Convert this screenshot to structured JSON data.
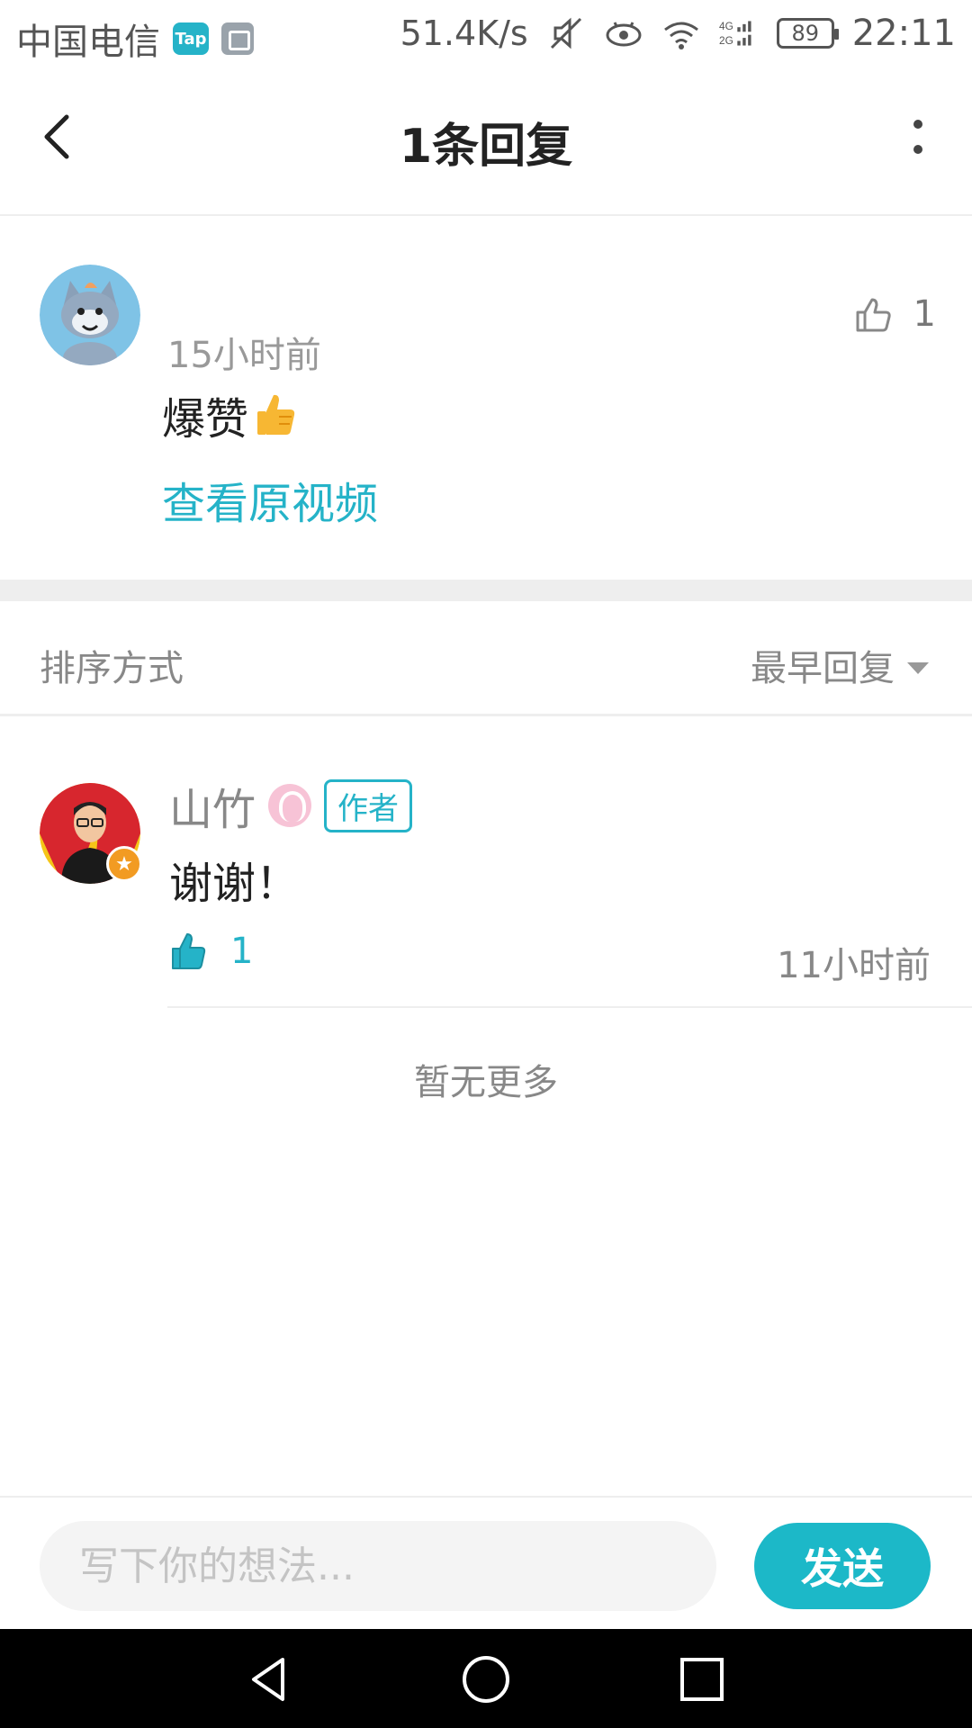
{
  "status_bar": {
    "carrier": "中国电信",
    "tap_badge": "Tap",
    "net_speed": "51.4K/s",
    "network_label_top": "4G",
    "network_label_bottom": "2G",
    "battery": "89",
    "time": "22:11"
  },
  "header": {
    "title": "1条回复"
  },
  "original_comment": {
    "time": "15小时前",
    "like_count": "1",
    "text": "爆赞",
    "view_video_link": "查看原视频"
  },
  "sort": {
    "label": "排序方式",
    "selected": "最早回复"
  },
  "reply": {
    "name": "山竹",
    "author_badge": "作者",
    "text": "谢谢！",
    "like_count": "1",
    "time": "11小时前"
  },
  "footer_text": "暂无更多",
  "input": {
    "placeholder": "写下你的想法...",
    "send_label": "发送"
  },
  "colors": {
    "accent": "#25b3c8",
    "send_button": "#1cb8c8",
    "muted_text": "#888888"
  }
}
